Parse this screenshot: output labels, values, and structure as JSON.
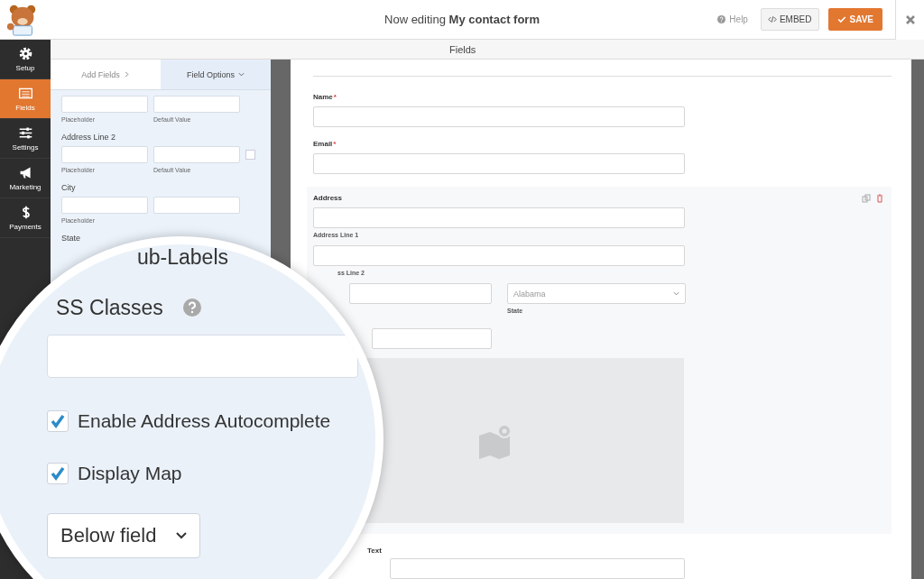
{
  "header": {
    "title": "Now editing **My contact form**",
    "help": "Help",
    "embed": "EMBED",
    "save": "SAVE"
  },
  "sidebar": {
    "items": [
      {
        "label": "Setup",
        "kind": "gear",
        "selected": false
      },
      {
        "label": "Fields",
        "kind": "list",
        "selected": true
      },
      {
        "label": "Settings",
        "kind": "sliders",
        "selected": false
      },
      {
        "label": "Marketing",
        "kind": "megaphone",
        "selected": false
      },
      {
        "label": "Payments",
        "kind": "dollar",
        "selected": false
      }
    ]
  },
  "section_title": "Fields",
  "panel": {
    "tabs": [
      {
        "label": "Add Fields",
        "kind": "next",
        "selected": false
      },
      {
        "label": "Field Options",
        "kind": "dropdown",
        "selected": true
      }
    ],
    "rows": [
      {
        "sublabels": [
          "Placeholder",
          "Default Value"
        ]
      },
      {
        "label": "Address Line 2",
        "sublabels": [
          "Placeholder",
          "Default Value"
        ],
        "checkbox": {
          "checked": false
        }
      },
      {
        "label": "City",
        "sublabels": [
          "Placeholder"
        ]
      }
    ],
    "last_label": "State"
  },
  "magnifier": {
    "sublabels_heading": "ub-Labels",
    "css_heading": "SS Classes",
    "checkboxes": [
      {
        "label": "Enable Address Autocomplete",
        "checked": true
      },
      {
        "label": "Display Map",
        "checked": true
      }
    ],
    "select_value": "Below field"
  },
  "form": {
    "fields": [
      {
        "label": "Name",
        "required_mark": "*"
      },
      {
        "label": "Email",
        "required_mark": "*"
      }
    ],
    "address": {
      "label": "Address",
      "line1": "Address Line 1",
      "line2": "ss Line 2",
      "state_value": "Alabama",
      "state_label": "State"
    },
    "help_label": "Text"
  }
}
